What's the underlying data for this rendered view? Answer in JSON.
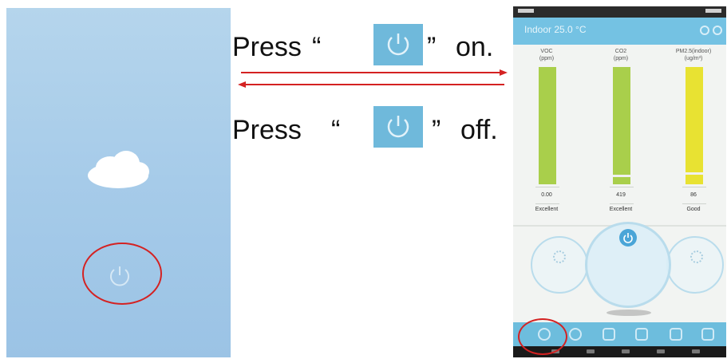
{
  "instructions": {
    "on": {
      "press": "Press",
      "open_quote": "“",
      "close_quote": "”",
      "action": "on."
    },
    "off": {
      "press": "Press",
      "open_quote": "“",
      "close_quote": "”",
      "action": "off."
    }
  },
  "phone": {
    "title": "Indoor 25.0 °C",
    "gauges": [
      {
        "name": "VOC",
        "unit": "(ppm)",
        "value": "0.00",
        "rating": "Excellent",
        "level": 1.0,
        "color": "#a9cf4b"
      },
      {
        "name": "CO2",
        "unit": "(ppm)",
        "value": "419",
        "rating": "Excellent",
        "level": 0.9,
        "color": "#a9cf4b"
      },
      {
        "name": "PM2.5(indoor)",
        "unit": "(ug/m³)",
        "value": "86",
        "rating": "Good",
        "level": 0.92,
        "color": "#e8e232"
      }
    ]
  },
  "colors": {
    "accent": "#74c2e3",
    "button": "#6fb9db",
    "highlight_ring": "#d42222",
    "arrow": "#d42222"
  },
  "icons": [
    "power-icon",
    "cloud-icon",
    "settings-icon",
    "info-icon",
    "fan-icon",
    "timer-icon",
    "menu-icon"
  ]
}
